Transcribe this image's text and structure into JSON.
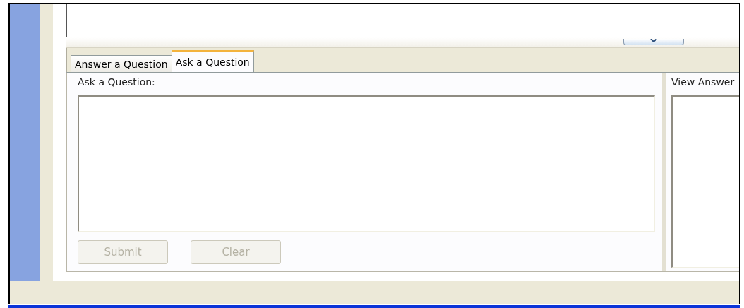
{
  "tabs": [
    {
      "label": "Answer a Question",
      "selected": false
    },
    {
      "label": "Ask a Question",
      "selected": true
    }
  ],
  "ask_panel": {
    "label": "Ask a Question:",
    "buttons": [
      {
        "label": "Submit",
        "disabled": true
      },
      {
        "label": "Clear",
        "disabled": true
      }
    ]
  },
  "answer_panel": {
    "label": "View Answer"
  }
}
